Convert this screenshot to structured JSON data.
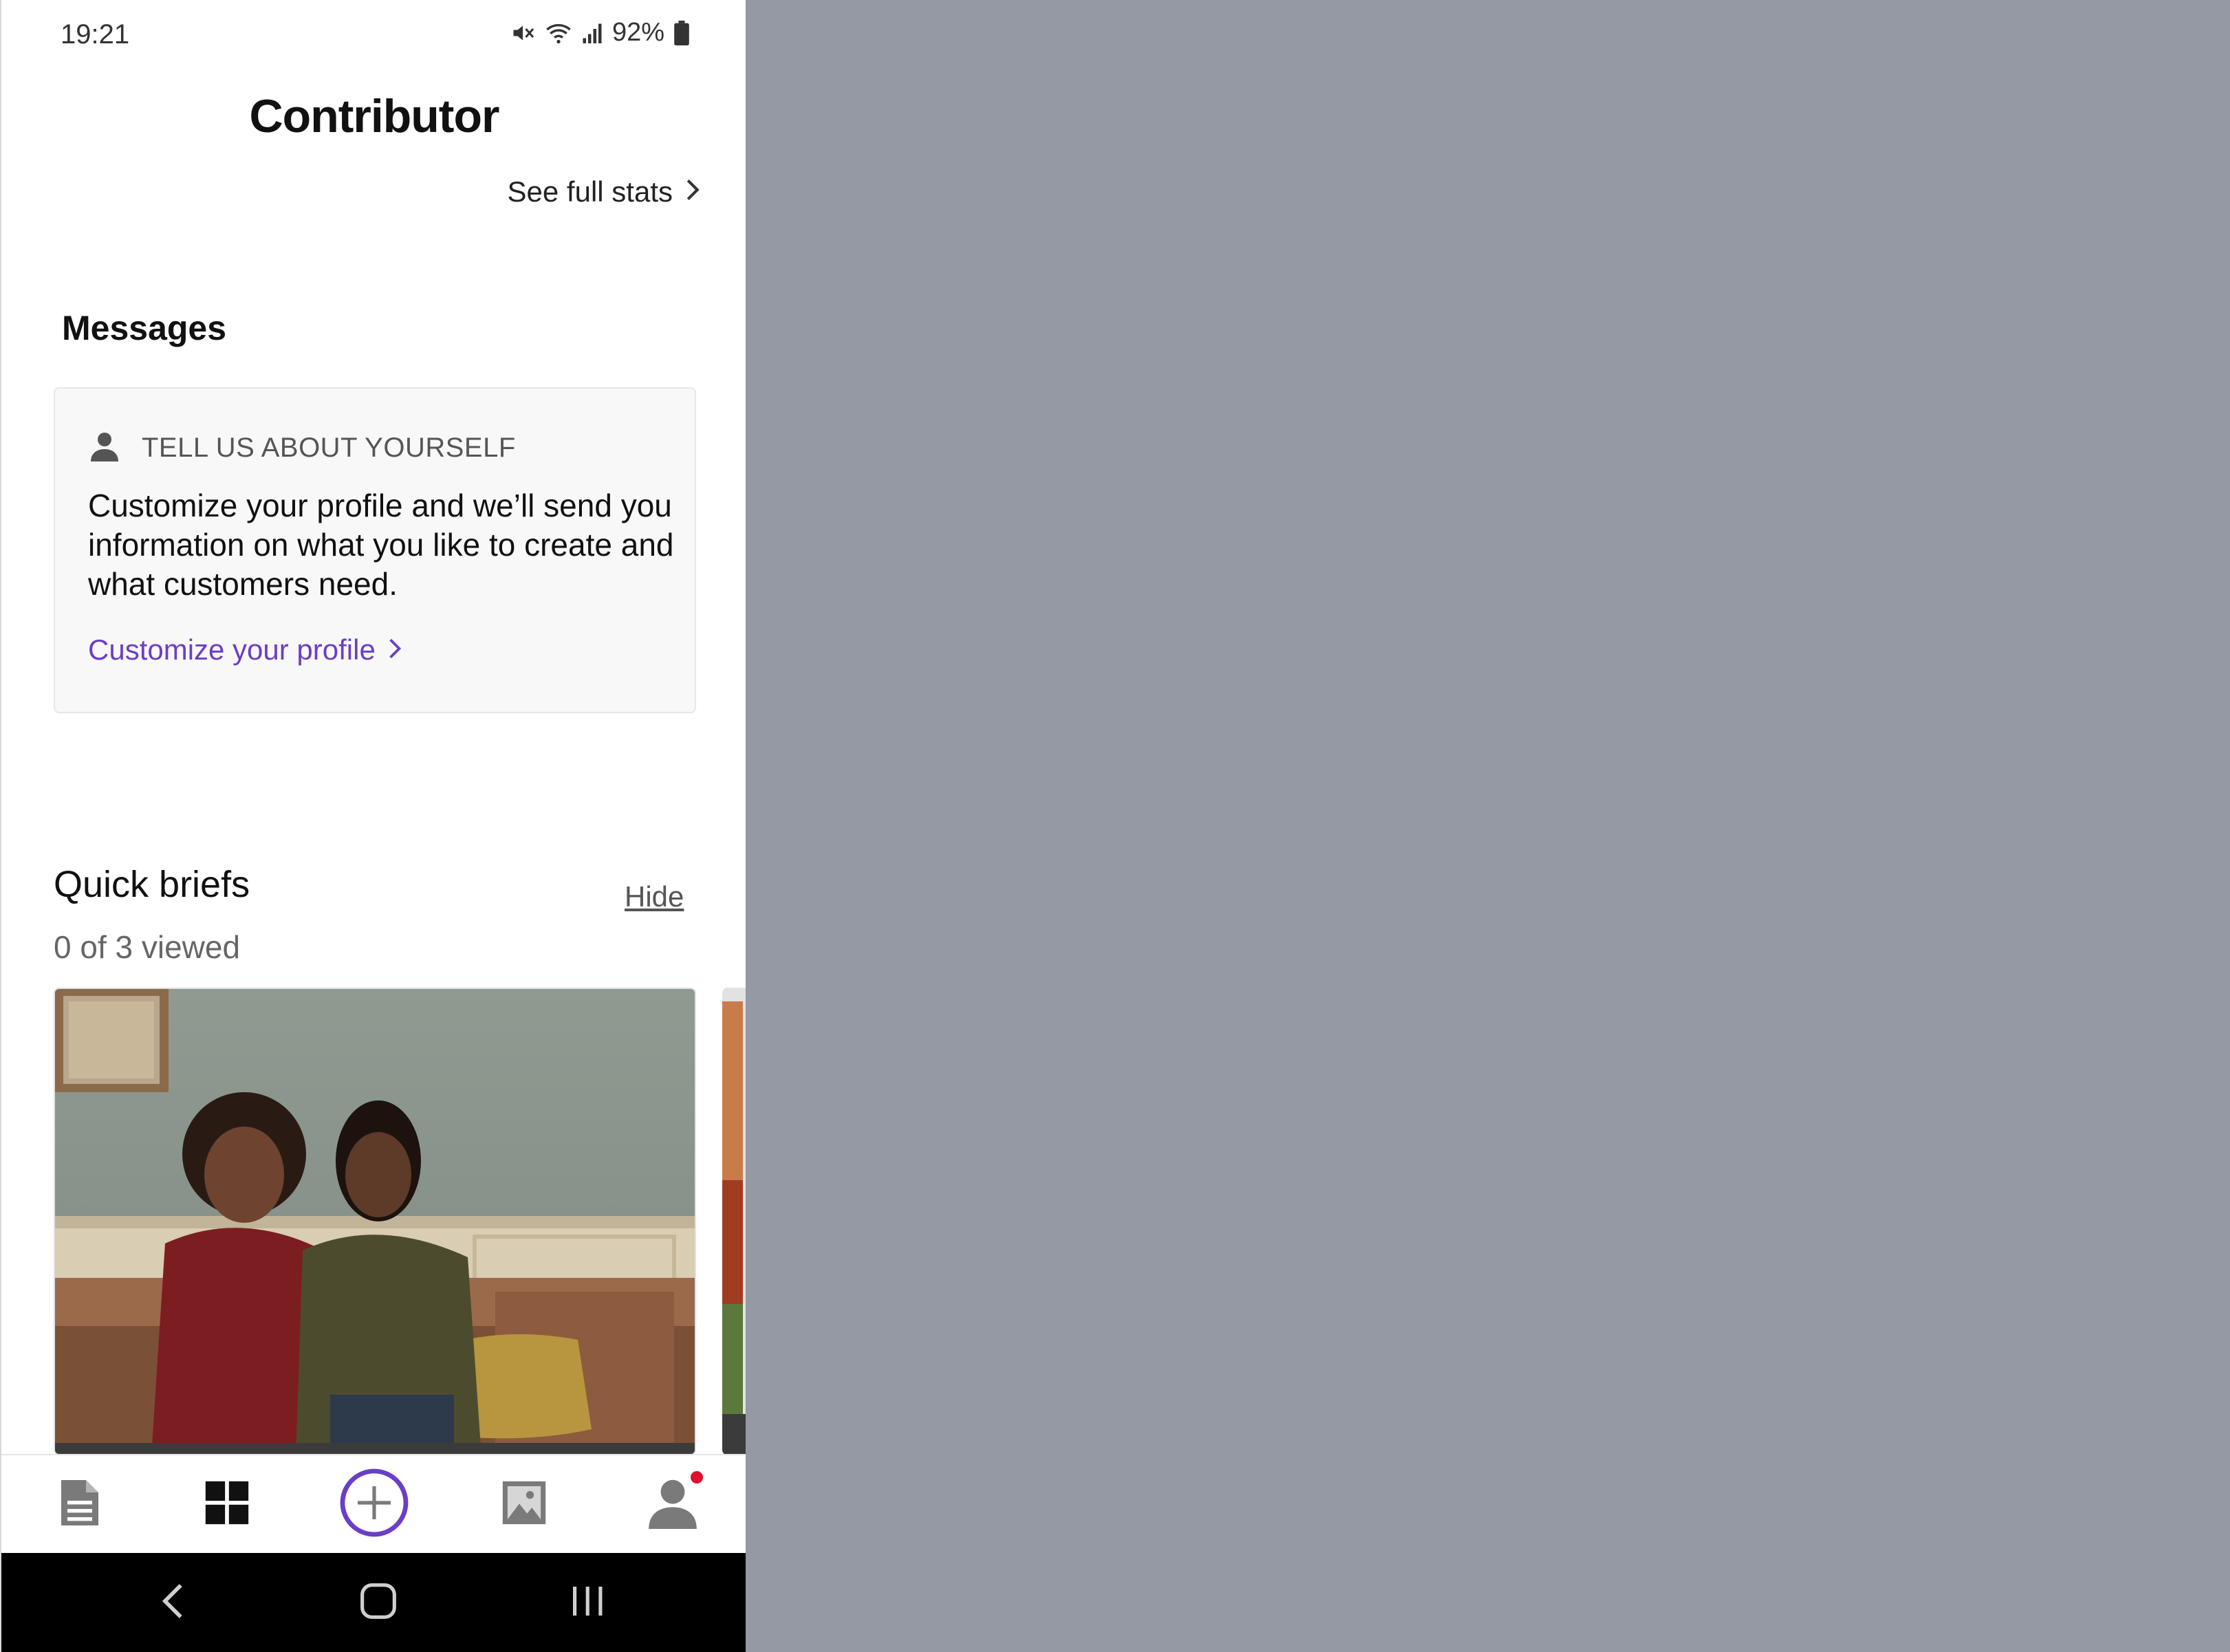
{
  "status_bar": {
    "time": "19:21",
    "battery_percent": "92%",
    "icons": [
      "mute-icon",
      "wifi-icon",
      "signal-icon",
      "battery-icon"
    ]
  },
  "header": {
    "title": "Contributor",
    "stats_link": "See full stats"
  },
  "messages": {
    "heading": "Messages",
    "card": {
      "icon": "person-icon",
      "label": "TELL US ABOUT YOURSELF",
      "body": "Customize your profile and we’ll send you information on what you like to create and what customers need.",
      "link": "Customize your profile"
    }
  },
  "quick_briefs": {
    "title": "Quick briefs",
    "hide_label": "Hide",
    "progress": "0 of 3 viewed"
  },
  "bottom_nav": {
    "items": [
      {
        "icon": "document-icon"
      },
      {
        "icon": "dashboard-grid-icon",
        "active": true
      },
      {
        "icon": "add-circle-icon"
      },
      {
        "icon": "image-icon"
      },
      {
        "icon": "profile-icon",
        "notification_dot": true
      }
    ]
  },
  "system_nav": {
    "buttons": [
      "back-icon",
      "home-icon",
      "recents-icon"
    ]
  },
  "colors": {
    "accent": "#6a3fc7",
    "notification": "#e0102b",
    "backdrop": "#9599a4"
  }
}
